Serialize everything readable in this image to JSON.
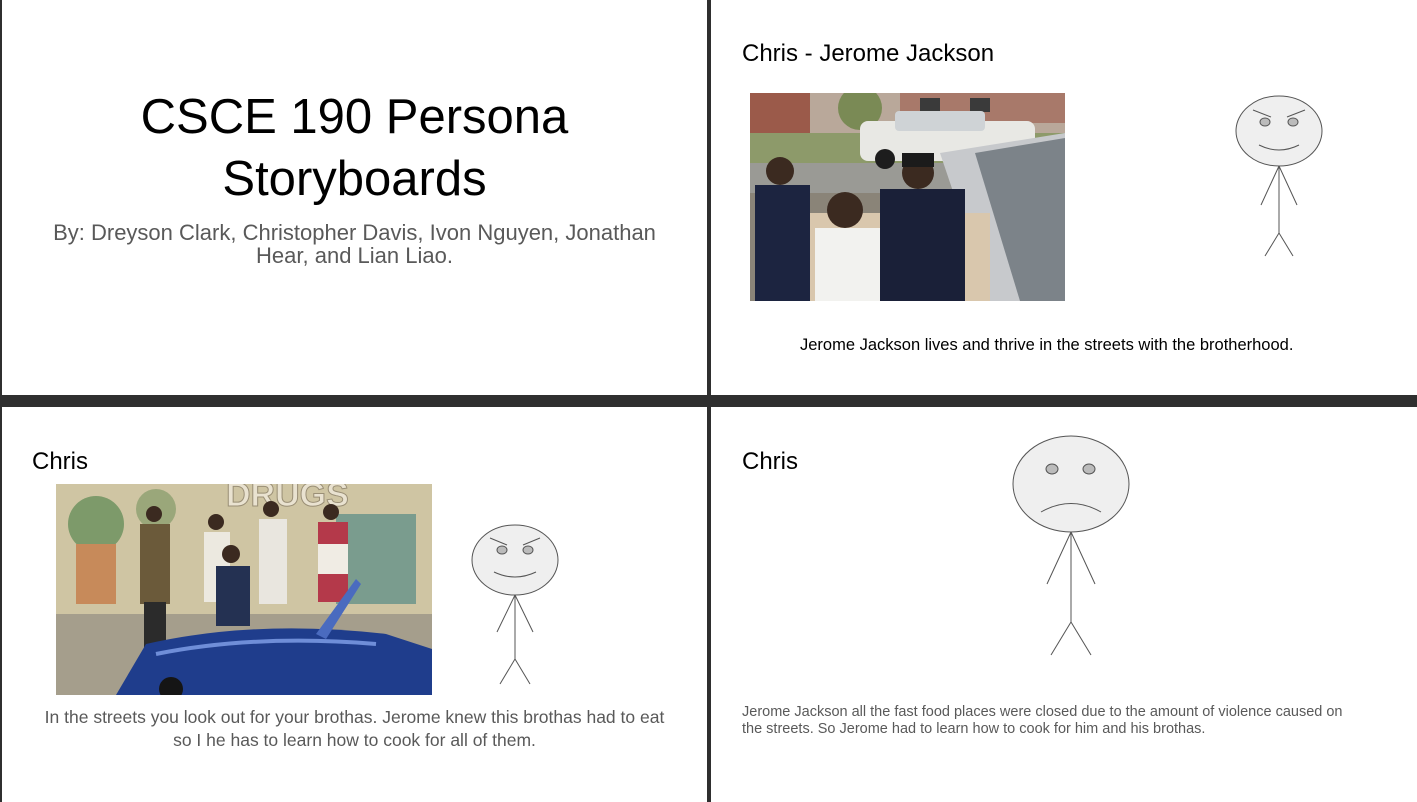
{
  "slide1": {
    "title_line1": "CSCE 190 Persona",
    "title_line2": "Storyboards",
    "subtitle_line1": "By: Dreyson Clark, Christopher Davis, Ivon Nguyen, Jonathan",
    "subtitle_line2": "Hear, and Lian Liao."
  },
  "slide2": {
    "heading": "Chris - Jerome Jackson",
    "caption": "Jerome Jackson lives and thrive in the streets with the brotherhood."
  },
  "slide3": {
    "heading": "Chris",
    "mural_text": "DRUGS",
    "caption_line1": "In the streets you look out for your brothas. Jerome knew this brothas had to eat",
    "caption_line2": "so I he has to learn how to cook for all of them."
  },
  "slide4": {
    "heading": "Chris",
    "caption_line1": "Jerome Jackson all the fast food places were closed due to the amount of violence caused on",
    "caption_line2": "the streets. So Jerome had to learn how to cook for him and his brothas."
  },
  "colors": {
    "divider": "#2f2f2f",
    "slide_bg": "#ffffff",
    "face_fill": "#efefef",
    "stroke": "#555555",
    "grey_text": "#595959"
  }
}
